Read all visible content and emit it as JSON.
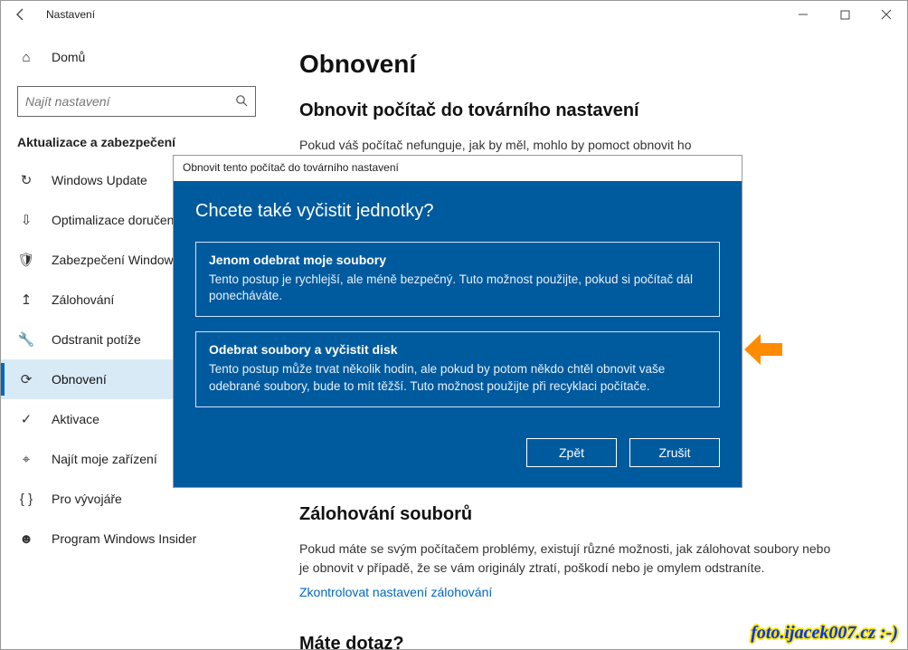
{
  "titlebar": {
    "title": "Nastavení"
  },
  "sidebar": {
    "home": "Domů",
    "search_placeholder": "Najít nastavení",
    "section": "Aktualizace a zabezpečení",
    "items": [
      {
        "icon": "↻",
        "label": "Windows Update"
      },
      {
        "icon": "⇩",
        "label": "Optimalizace doručení"
      },
      {
        "icon": "🛡",
        "label": "Zabezpečení Windows"
      },
      {
        "icon": "↥",
        "label": "Zálohování"
      },
      {
        "icon": "🔧",
        "label": "Odstranit potíže"
      },
      {
        "icon": "⟳",
        "label": "Obnovení"
      },
      {
        "icon": "✓",
        "label": "Aktivace"
      },
      {
        "icon": "⌖",
        "label": "Najít moje zařízení"
      },
      {
        "icon": "{ }",
        "label": "Pro vývojáře"
      },
      {
        "icon": "☻",
        "label": "Program Windows Insider"
      }
    ],
    "selected_index": 5
  },
  "main": {
    "heading": "Obnovení",
    "reset_section_heading": "Obnovit počítač do továrního nastavení",
    "reset_text": "Pokud váš počítač nefunguje, jak by měl, mohlo by pomoct obnovit ho",
    "backup_heading": "Zálohování souborů",
    "backup_text": "Pokud máte se svým počítačem problémy, existují různé možnosti, jak zálohovat soubory nebo je obnovit v případě, že se vám originály ztratí, poškodí nebo je omylem odstraníte.",
    "backup_link": "Zkontrolovat nastavení zálohování",
    "faq_heading": "Máte dotaz?"
  },
  "modal": {
    "window_title": "Obnovit tento počítač do továrního nastavení",
    "heading": "Chcete také vyčistit jednotky?",
    "options": [
      {
        "title": "Jenom odebrat moje soubory",
        "desc": "Tento postup je rychlejší, ale méně bezpečný. Tuto možnost použijte, pokud si počítač dál ponecháváte."
      },
      {
        "title": "Odebrat soubory a vyčistit disk",
        "desc": "Tento postup může trvat několik hodin, ale pokud by potom někdo chtěl obnovit vaše odebrané soubory, bude to mít těžší. Tuto možnost použijte při recyklaci počítače."
      }
    ],
    "back": "Zpět",
    "cancel": "Zrušit"
  },
  "watermark": "foto.ijacek007.cz :-)"
}
